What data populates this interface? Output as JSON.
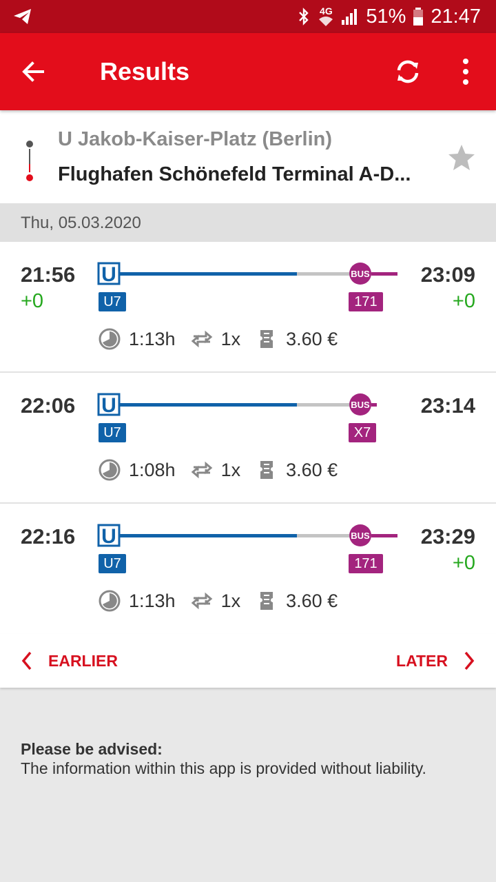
{
  "status_bar": {
    "network": "4G",
    "battery": "51%",
    "time": "21:47",
    "icons": [
      "telegram-icon",
      "bluetooth-icon",
      "wifi-icon",
      "signal-icon",
      "battery-icon"
    ]
  },
  "app_bar": {
    "title": "Results",
    "icons": [
      "back-arrow-icon",
      "refresh-icon",
      "more-vert-icon"
    ]
  },
  "route": {
    "from": "U Jakob-Kaiser-Platz (Berlin)",
    "to": "Flughafen Schönefeld Terminal A-D...",
    "favorite_icon": "star-icon"
  },
  "date": "Thu, 05.03.2020",
  "trips": [
    {
      "departure": "21:56",
      "dep_delay": "+0",
      "arrival": "23:09",
      "arr_delay": "+0",
      "leg1": "U7",
      "leg2": "171",
      "duration": "1:13h",
      "changes": "1x",
      "price": "3.60 €"
    },
    {
      "departure": "22:06",
      "dep_delay": "",
      "arrival": "23:14",
      "arr_delay": "",
      "leg1": "U7",
      "leg2": "X7",
      "duration": "1:08h",
      "changes": "1x",
      "price": "3.60 €"
    },
    {
      "departure": "22:16",
      "dep_delay": "",
      "arrival": "23:29",
      "arr_delay": "+0",
      "leg1": "U7",
      "leg2": "171",
      "duration": "1:13h",
      "changes": "1x",
      "price": "3.60 €"
    }
  ],
  "pager": {
    "earlier": "EARLIER",
    "later": "LATER"
  },
  "advice": {
    "heading": "Please be advised:",
    "text": "The information within this app is provided without liability."
  },
  "colors": {
    "brand_red": "#e30d1b",
    "status_red": "#b10b1a",
    "ubahn_blue": "#1062a9",
    "bus_purple": "#a3247e",
    "delay_green": "#25a81e"
  }
}
